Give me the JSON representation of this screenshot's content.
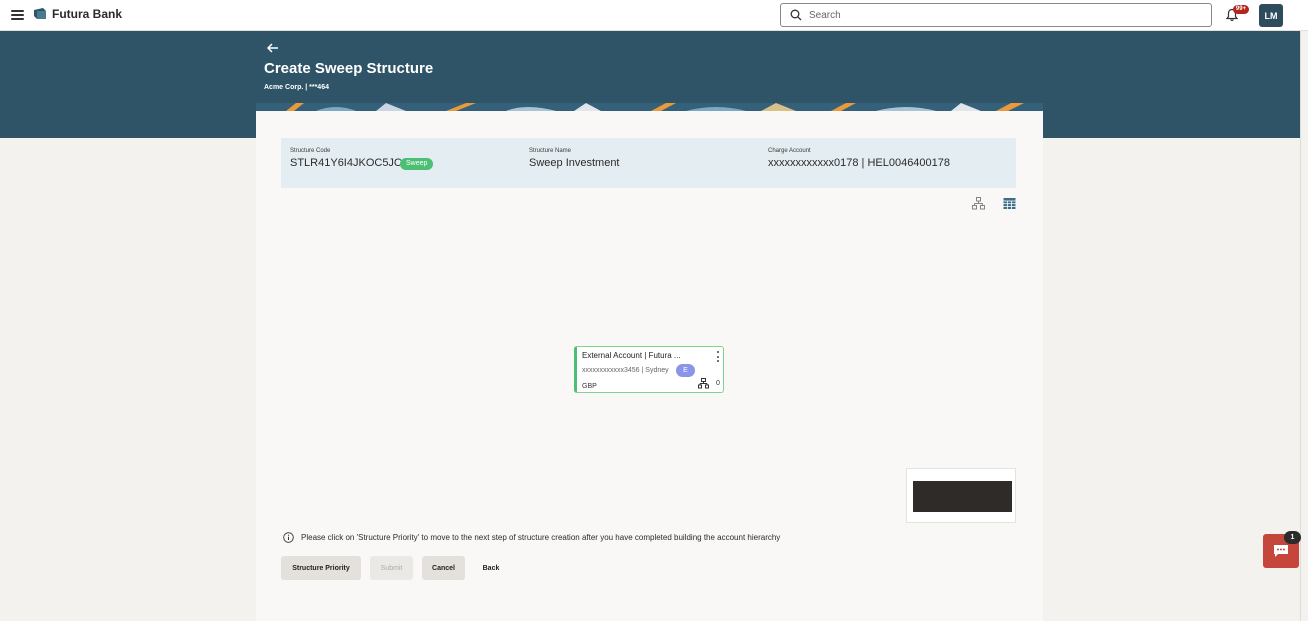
{
  "app": {
    "brand": "Futura Bank",
    "notification_count": "99+",
    "avatar_initials": "LM"
  },
  "search": {
    "placeholder": "Search"
  },
  "page": {
    "title": "Create Sweep Structure",
    "subtitle": "Acme Corp. | ***464"
  },
  "structure": {
    "code_label": "Structure Code",
    "code": "STLR41Y6I4JKOC5JC",
    "type_badge": "Sweep",
    "name_label": "Structure Name",
    "name": "Sweep Investment",
    "charge_label": "Charge Account",
    "charge_account": "xxxxxxxxxxxx0178 | HEL0046400178"
  },
  "node": {
    "title": "External Account | Futura ...",
    "account": "xxxxxxxxxxxx3456 | Sydney",
    "type_tag": "E",
    "currency": "GBP",
    "child_count": "0"
  },
  "note": {
    "text": "Please click on 'Structure Priority' to move to the next step of structure creation after you have completed building the account hierarchy"
  },
  "actions": {
    "structure_priority": "Structure Priority",
    "submit": "Submit",
    "cancel": "Cancel",
    "back": "Back"
  },
  "chat": {
    "badge": "1"
  },
  "icons": {
    "menu": "hamburger-icon",
    "logo": "bank-logo-icon",
    "search": "search-icon",
    "bell": "bell-icon",
    "back": "back-arrow-icon",
    "tree_view": "tree-view-icon",
    "table_view": "table-view-icon",
    "kebab": "kebab-menu-icon",
    "hierarchy": "hierarchy-icon",
    "info": "info-icon",
    "chat": "chat-icon"
  },
  "colors": {
    "banner": "#2f5468",
    "sweep_badge": "#4bbf73",
    "node_border": "#4bbf73",
    "type_tag": "#8a95e8",
    "notification_badge": "#b3261e",
    "chat_button": "#c5473b",
    "avatar": "#2f4c5e"
  }
}
